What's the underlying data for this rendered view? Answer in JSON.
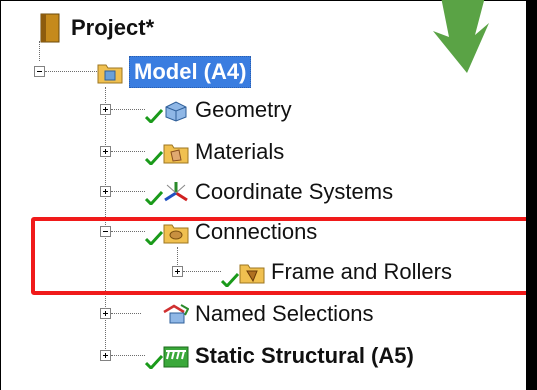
{
  "tree": {
    "root": {
      "label": "Project*",
      "icon": "project-book-icon"
    },
    "model": {
      "label": "Model (A4)",
      "icon": "model-folder-icon",
      "selected": true
    },
    "children": [
      {
        "label": "Geometry",
        "icon": "geometry-cube-icon",
        "status": "check"
      },
      {
        "label": "Materials",
        "icon": "materials-folder-icon",
        "status": "check"
      },
      {
        "label": "Coordinate Systems",
        "icon": "coordinate-axes-icon",
        "status": "check"
      },
      {
        "label": "Connections",
        "icon": "connections-folder-icon",
        "status": "check",
        "expanded": true,
        "children": [
          {
            "label": "Frame and Rollers",
            "icon": "contact-folder-icon",
            "status": "check"
          }
        ]
      },
      {
        "label": "Named Selections",
        "icon": "named-selections-icon",
        "status": "none"
      },
      {
        "label": "Static Structural (A5)",
        "icon": "static-structural-icon",
        "status": "check"
      }
    ]
  },
  "highlight": {
    "target": "Connections",
    "color": "#f01a1a"
  },
  "colors": {
    "check": "#1a9a1a",
    "selection": "#3a7de0",
    "arrow": "#5aa345"
  }
}
